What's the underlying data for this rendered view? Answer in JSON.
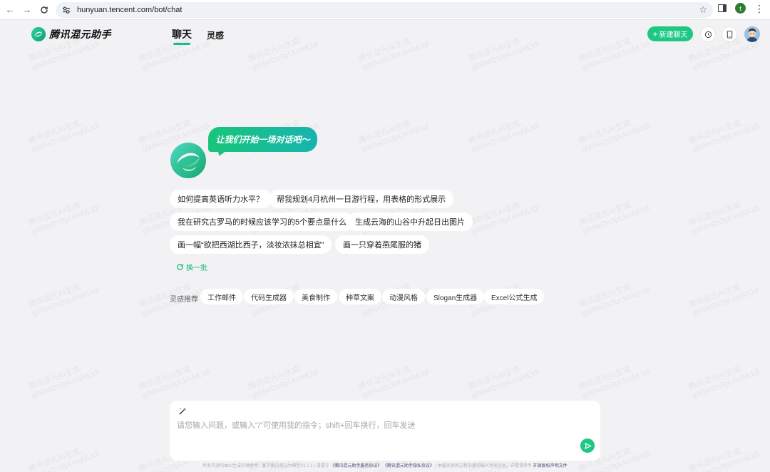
{
  "browser": {
    "url": "hunyuan.tencent.com/bot/chat",
    "profile_initial": "t"
  },
  "header": {
    "brand": "腾讯混元助手",
    "tabs": [
      {
        "label": "聊天",
        "active": true
      },
      {
        "label": "灵感",
        "active": false
      }
    ],
    "new_chat_label": "新建聊天"
  },
  "watermark": {
    "line1": "腾讯混元AI生成",
    "line2": "gW6eDs3pLknA8Jdl"
  },
  "welcome": {
    "greeting": "让我们开始一场对话吧～",
    "suggestions": [
      "如何提高英语听力水平？",
      "帮我规划4月杭州一日游行程，用表格的形式展示",
      "我在研究古罗马的时候应该学习的5个要点是什么",
      "生成云海的山谷中升起日出图片",
      "画一幅“欲把西湖比西子，淡妆浓抹总相宜”",
      "画一只穿着燕尾服的猪"
    ],
    "refresh_label": "换一批"
  },
  "inspiration": {
    "label": "灵感推荐",
    "chips": [
      "工作邮件",
      "代码生成器",
      "美食制作",
      "种草文案",
      "动漫风格",
      "Slogan生成器",
      "Excel公式生成"
    ]
  },
  "composer": {
    "placeholder": "请您输入问题，或输入\"/\"可使用我的指令；shift+回车换行，回车发送"
  },
  "footer": {
    "prefix": "所有内容均由AI生成仅供参考 · 基于腾讯混元大模型V1.7.1 | 请遵守",
    "terms_link": "《腾讯混元助手服务协议》",
    "privacy_link": "《腾讯混元助手隐私协议》",
    "middle": " | 本服务使用过程中请勿输入涉密信息，详情请参考",
    "license_link": "开源版权声明文件"
  },
  "colors": {
    "accent": "#1fc785",
    "background": "#f2f2f4"
  }
}
